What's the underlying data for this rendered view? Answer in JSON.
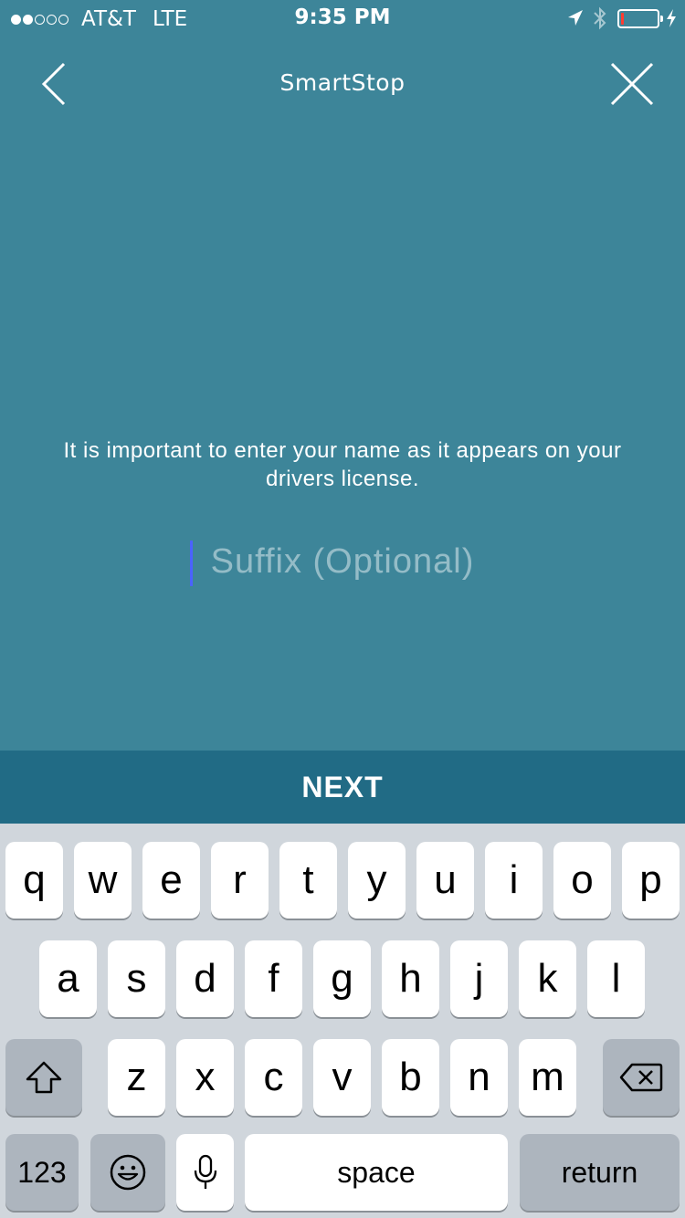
{
  "status_bar": {
    "carrier": "AT&T",
    "network": "LTE",
    "time": "9:35 PM",
    "signal_bars_filled": 2,
    "signal_bars_total": 5,
    "battery_level_percent": 8,
    "battery_color": "#ff3b30"
  },
  "nav": {
    "title": "SmartStop",
    "back_icon": "chevron-left-icon",
    "close_icon": "close-icon"
  },
  "form": {
    "instruction": "It is important to enter your name as it appears on your drivers license.",
    "suffix_placeholder": "Suffix (Optional)",
    "suffix_value": ""
  },
  "next_button": {
    "label": "NEXT"
  },
  "keyboard": {
    "row1": [
      "q",
      "w",
      "e",
      "r",
      "t",
      "y",
      "u",
      "i",
      "o",
      "p"
    ],
    "row2": [
      "a",
      "s",
      "d",
      "f",
      "g",
      "h",
      "j",
      "k",
      "l"
    ],
    "row3": [
      "z",
      "x",
      "c",
      "v",
      "b",
      "n",
      "m"
    ],
    "numbers_label": "123",
    "space_label": "space",
    "return_label": "return",
    "shift_icon": "shift-icon",
    "delete_icon": "backspace-icon",
    "emoji_icon": "emoji-icon",
    "mic_icon": "microphone-icon"
  },
  "colors": {
    "background": "#3d8599",
    "next_bar": "#216b85",
    "caret": "#4b62ff",
    "keyboard_bg": "#d0d6dc"
  }
}
